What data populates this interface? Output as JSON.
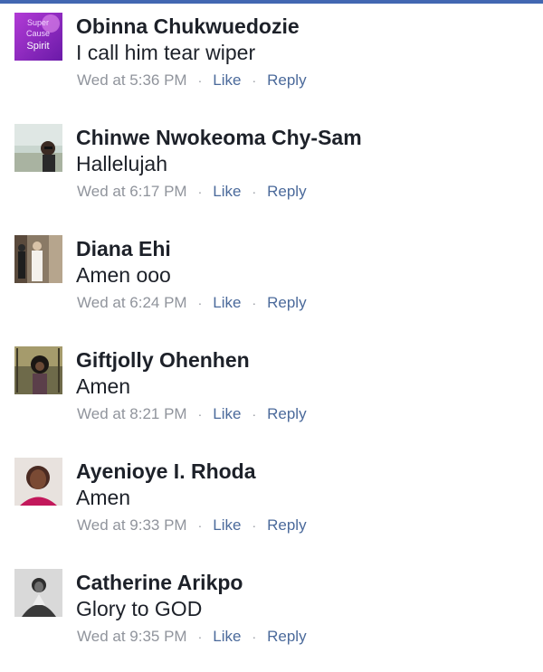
{
  "comments": [
    {
      "author": "Obinna Chukwuedozie",
      "text": "I call him tear wiper",
      "time": "Wed at 5:36 PM",
      "avatar_text": "Supernatural Cause Spirit"
    },
    {
      "author": "Chinwe Nwokeoma Chy-Sam",
      "text": "Hallelujah",
      "time": "Wed at 6:17 PM"
    },
    {
      "author": "Diana Ehi",
      "text": "Amen ooo",
      "time": "Wed at 6:24 PM"
    },
    {
      "author": "Giftjolly Ohenhen",
      "text": "Amen",
      "time": "Wed at 8:21 PM"
    },
    {
      "author": "Ayenioye I. Rhoda",
      "text": "Amen",
      "time": "Wed at 9:33 PM"
    },
    {
      "author": "Catherine Arikpo",
      "text": "Glory to GOD",
      "time": "Wed at 9:35 PM"
    }
  ],
  "actions": {
    "like_label": "Like",
    "reply_label": "Reply",
    "separator": "·"
  },
  "colors": {
    "top_bar": "#4267b2",
    "author_text": "#1d2129",
    "meta_text": "#90949c",
    "action_link": "#4b6a9b"
  }
}
